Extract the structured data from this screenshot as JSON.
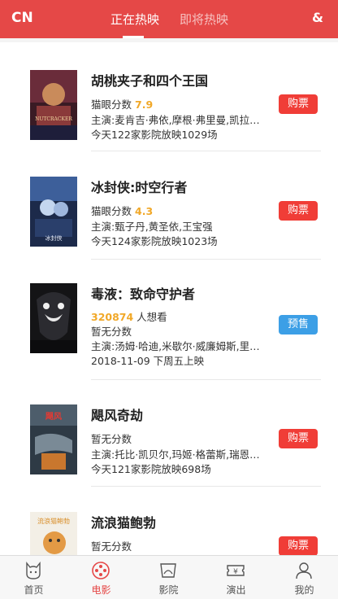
{
  "header": {
    "city": "CN",
    "tab_now": "正在热映",
    "tab_soon": "即将热映",
    "search_icon": "&"
  },
  "movies": [
    {
      "title": "胡桃夹子和四个王国",
      "score_label": "猫眼分数",
      "score": "7.9",
      "cast": "主演:麦肯吉·弗依,摩根·弗里曼,凯拉·奈特莉",
      "show": "今天122家影院放映1029场",
      "button": "购票",
      "button_type": "buy"
    },
    {
      "title": "冰封侠:时空行者",
      "score_label": "猫眼分数",
      "score": "4.3",
      "cast": "主演:甄子丹,黄圣依,王宝强",
      "show": "今天124家影院放映1023场",
      "button": "购票",
      "button_type": "buy"
    },
    {
      "title": "毒液：致命守护者",
      "want_num": "320874",
      "want_label": " 人想看",
      "no_score": "暂无分数",
      "cast": "主演:汤姆·哈迪,米歇尔·威廉姆斯,里兹·阿迈德",
      "show": "2018-11-09 下周五上映",
      "button": "预售",
      "button_type": "presale"
    },
    {
      "title": "飓风奇劫",
      "no_score": "暂无分数",
      "cast": "主演:托比·凯贝尔,玛姬·格蕾斯,瑞恩·科万腾",
      "show": "今天121家影院放映698场",
      "button": "购票",
      "button_type": "buy"
    },
    {
      "title": "流浪猫鲍勃",
      "no_score": "暂无分数",
      "button": "购票",
      "button_type": "buy"
    }
  ],
  "tabbar": {
    "items": [
      {
        "label": "首页",
        "icon": "home-cat-icon"
      },
      {
        "label": "电影",
        "icon": "film-reel-icon"
      },
      {
        "label": "影院",
        "icon": "cinema-screen-icon"
      },
      {
        "label": "演出",
        "icon": "ticket-icon"
      },
      {
        "label": "我的",
        "icon": "user-icon"
      }
    ]
  },
  "colors": {
    "brand": "#e54847",
    "buy": "#f03d37",
    "presale": "#3c9fe6",
    "score": "#f1a828"
  }
}
